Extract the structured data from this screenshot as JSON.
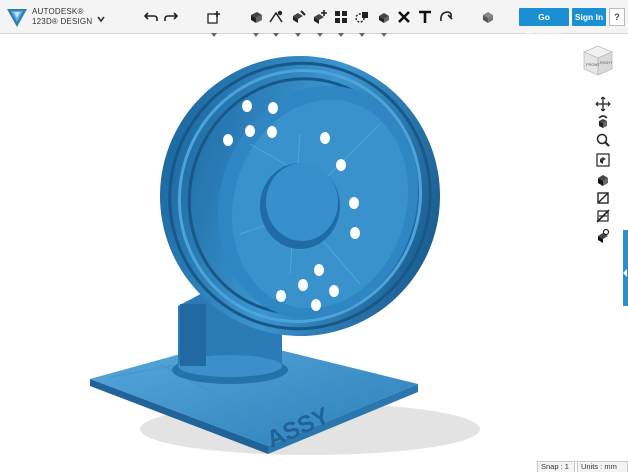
{
  "app": {
    "brand_line1": "AUTODESK®",
    "brand_line2": "123D® DESIGN"
  },
  "toolbar": {
    "left_icons": [
      "undo-icon",
      "redo-icon"
    ],
    "primitives_icon": "add-primitive-icon",
    "tools": [
      "sketch-icon",
      "construct-icon",
      "modify-icon",
      "pattern-icon",
      "group-icon",
      "combine-icon",
      "measure-icon",
      "delete-icon",
      "text-icon",
      "snap-icon"
    ],
    "material_icon": "material-icon",
    "go_premium_label": "Go Premium",
    "sign_in_label": "Sign In",
    "help_label": "?"
  },
  "viewcube": {
    "front_label": "FRONT",
    "right_label": "RIGHT"
  },
  "nav": {
    "icons": [
      "pan-icon",
      "orbit-icon",
      "zoom-icon",
      "fit-icon",
      "view-solid-icon",
      "view-outline-icon",
      "hide-icon",
      "materials-view-icon"
    ]
  },
  "status": {
    "snap": "Snap : 1",
    "units": "Units : mm"
  },
  "colors": {
    "accent": "#1a8fd1",
    "model": "#2d86c2",
    "model_dark": "#1d5f8f",
    "model_light": "#5ba9dc"
  }
}
